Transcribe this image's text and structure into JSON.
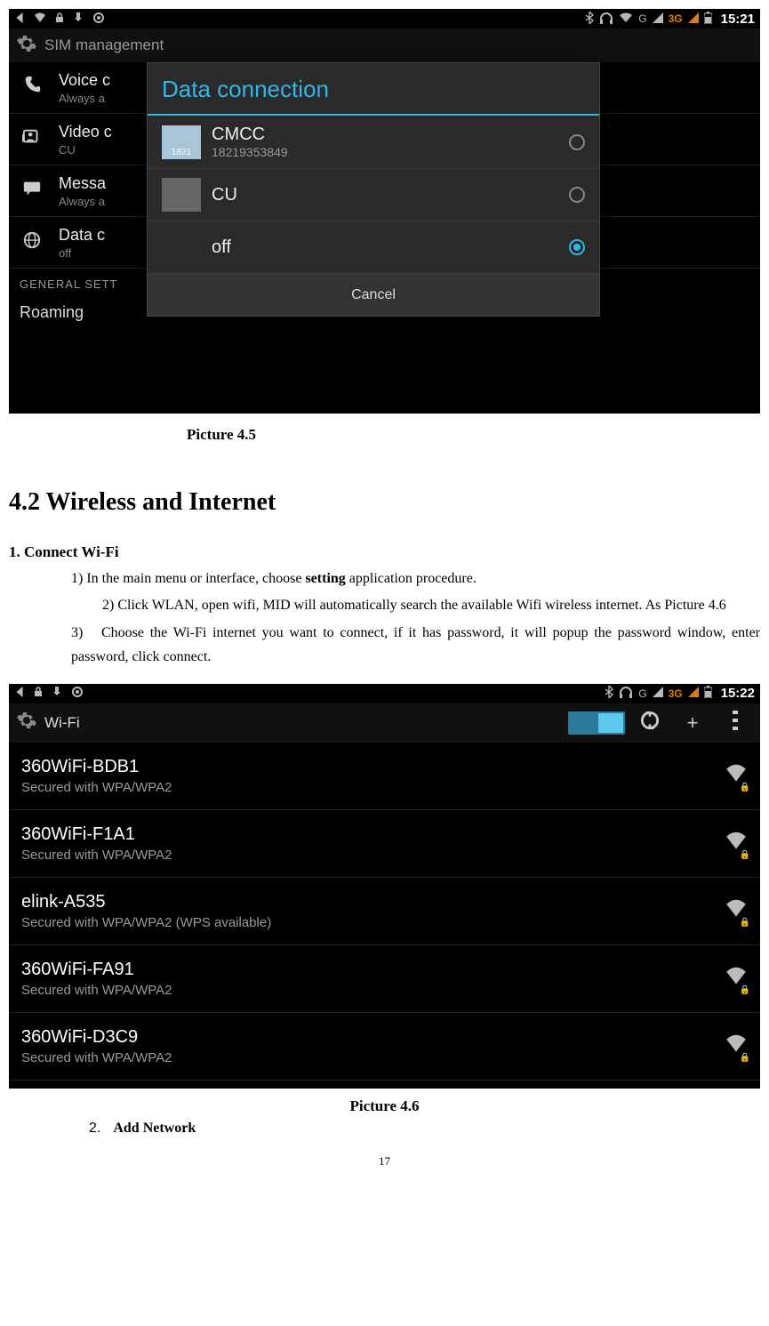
{
  "statusbar1": {
    "time": "15:21",
    "labels": {
      "g": "G",
      "threeg": "3G"
    }
  },
  "bg": {
    "header": "SIM management",
    "rows": [
      {
        "title": "Voice c",
        "sub": "Always a"
      },
      {
        "title": "Video c",
        "sub": "CU"
      },
      {
        "title": "Messa",
        "sub": "Always a"
      },
      {
        "title": "Data c",
        "sub": "off"
      }
    ],
    "section": "GENERAL SETT",
    "roaming": "Roaming"
  },
  "dialog": {
    "title": "Data connection",
    "options": [
      {
        "carrier": "CMCC",
        "number": "18219353849",
        "chip_label": "1821",
        "selected": false,
        "has_chip": true,
        "chip_gray": false
      },
      {
        "carrier": "CU",
        "number": "",
        "chip_label": "",
        "selected": false,
        "has_chip": true,
        "chip_gray": true
      },
      {
        "carrier": "off",
        "number": "",
        "chip_label": "",
        "selected": true,
        "has_chip": false,
        "chip_gray": false
      }
    ],
    "cancel": "Cancel"
  },
  "caption1": "Picture 4.5",
  "heading": "4.2 Wireless and Internet",
  "sub1": "1. Connect Wi-Fi",
  "p1_pre": "1) In the main menu or interface, choose ",
  "p1_bold": "setting",
  "p1_post": " application procedure.",
  "p2": "2) Click WLAN, open wifi, MID will automatically search the available Wifi wireless internet. As Picture 4.6",
  "p3_num": "3)",
  "p3": "Choose the Wi-Fi internet you want to connect, if it has password, it will popup the password window, enter password, click connect.",
  "statusbar2": {
    "time": "15:22",
    "labels": {
      "g": "G",
      "threeg": "3G"
    }
  },
  "wifi": {
    "title": "Wi-Fi",
    "toggle_on": true,
    "plus": "+",
    "networks": [
      {
        "ssid": "360WiFi-BDB1",
        "security": "Secured with WPA/WPA2"
      },
      {
        "ssid": "360WiFi-F1A1",
        "security": "Secured with WPA/WPA2"
      },
      {
        "ssid": "elink-A535",
        "security": "Secured with WPA/WPA2 (WPS available)"
      },
      {
        "ssid": "360WiFi-FA91",
        "security": "Secured with WPA/WPA2"
      },
      {
        "ssid": "360WiFi-D3C9",
        "security": "Secured with WPA/WPA2"
      }
    ]
  },
  "caption2": "Picture 4.6",
  "addnet_num": "2.",
  "addnet": "Add Network",
  "pagenum": "17"
}
